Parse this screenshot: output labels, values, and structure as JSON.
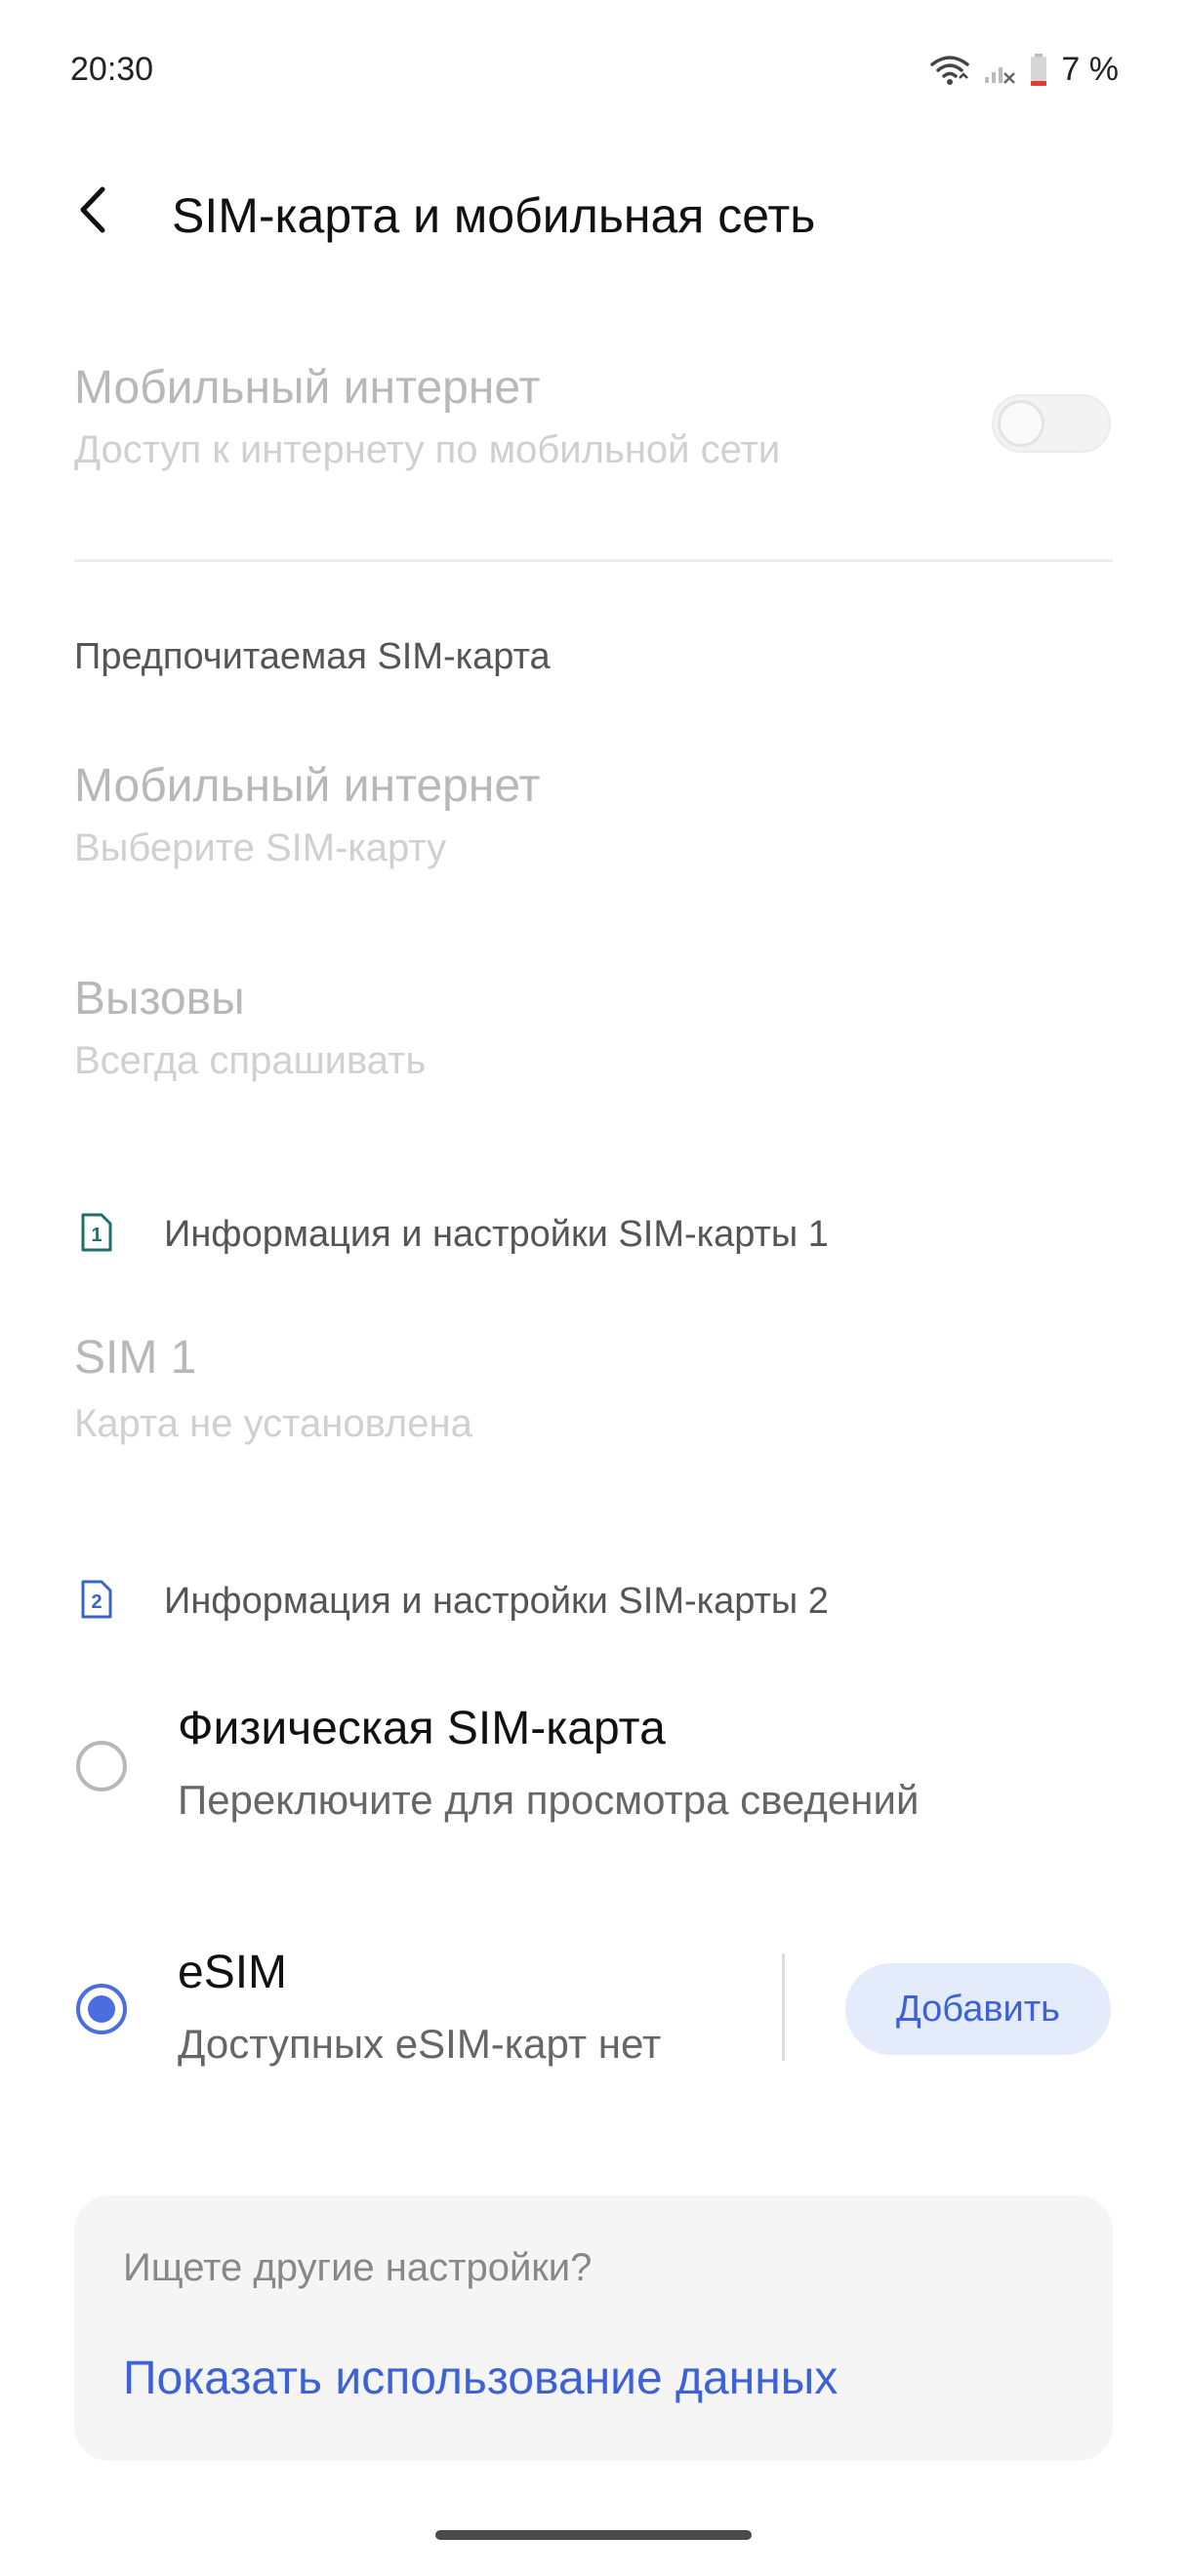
{
  "status_bar": {
    "time": "20:30",
    "battery": "7 %",
    "icons": [
      "wifi-icon",
      "cellular-no-signal-icon",
      "battery-low-icon"
    ]
  },
  "header": {
    "back_icon": "back-arrow-icon",
    "title": "SIM-карта и мобильная сеть"
  },
  "mobile_internet": {
    "title": "Мобильный интернет",
    "subtitle": "Доступ к интернету по мобильной сети",
    "enabled": false
  },
  "preferred_sim": {
    "section_label": "Предпочитаемая SIM-карта",
    "items": [
      {
        "title": "Мобильный интернет",
        "subtitle": "Выберите SIM-карту"
      },
      {
        "title": "Вызовы",
        "subtitle": "Всегда спрашивать"
      }
    ]
  },
  "sim1": {
    "section_label": "Информация и настройки SIM-карты 1",
    "icon_number": "1",
    "title": "SIM 1",
    "subtitle": "Карта не установлена"
  },
  "sim2": {
    "section_label": "Информация и настройки SIM-карты 2",
    "icon_number": "2",
    "options": [
      {
        "title": "Физическая SIM-карта",
        "subtitle": "Переключите для просмотра сведений",
        "selected": false
      },
      {
        "title": "eSIM",
        "subtitle": "Доступных eSIM-карт нет",
        "selected": true
      }
    ],
    "add_button": "Добавить"
  },
  "suggestion": {
    "question": "Ищете другие настройки?",
    "link": "Показать использование данных"
  },
  "colors": {
    "accent": "#4a6ee0",
    "sim1_icon": "#1f6e6a",
    "sim2_icon": "#3a63c9",
    "battery_low": "#e53935"
  }
}
